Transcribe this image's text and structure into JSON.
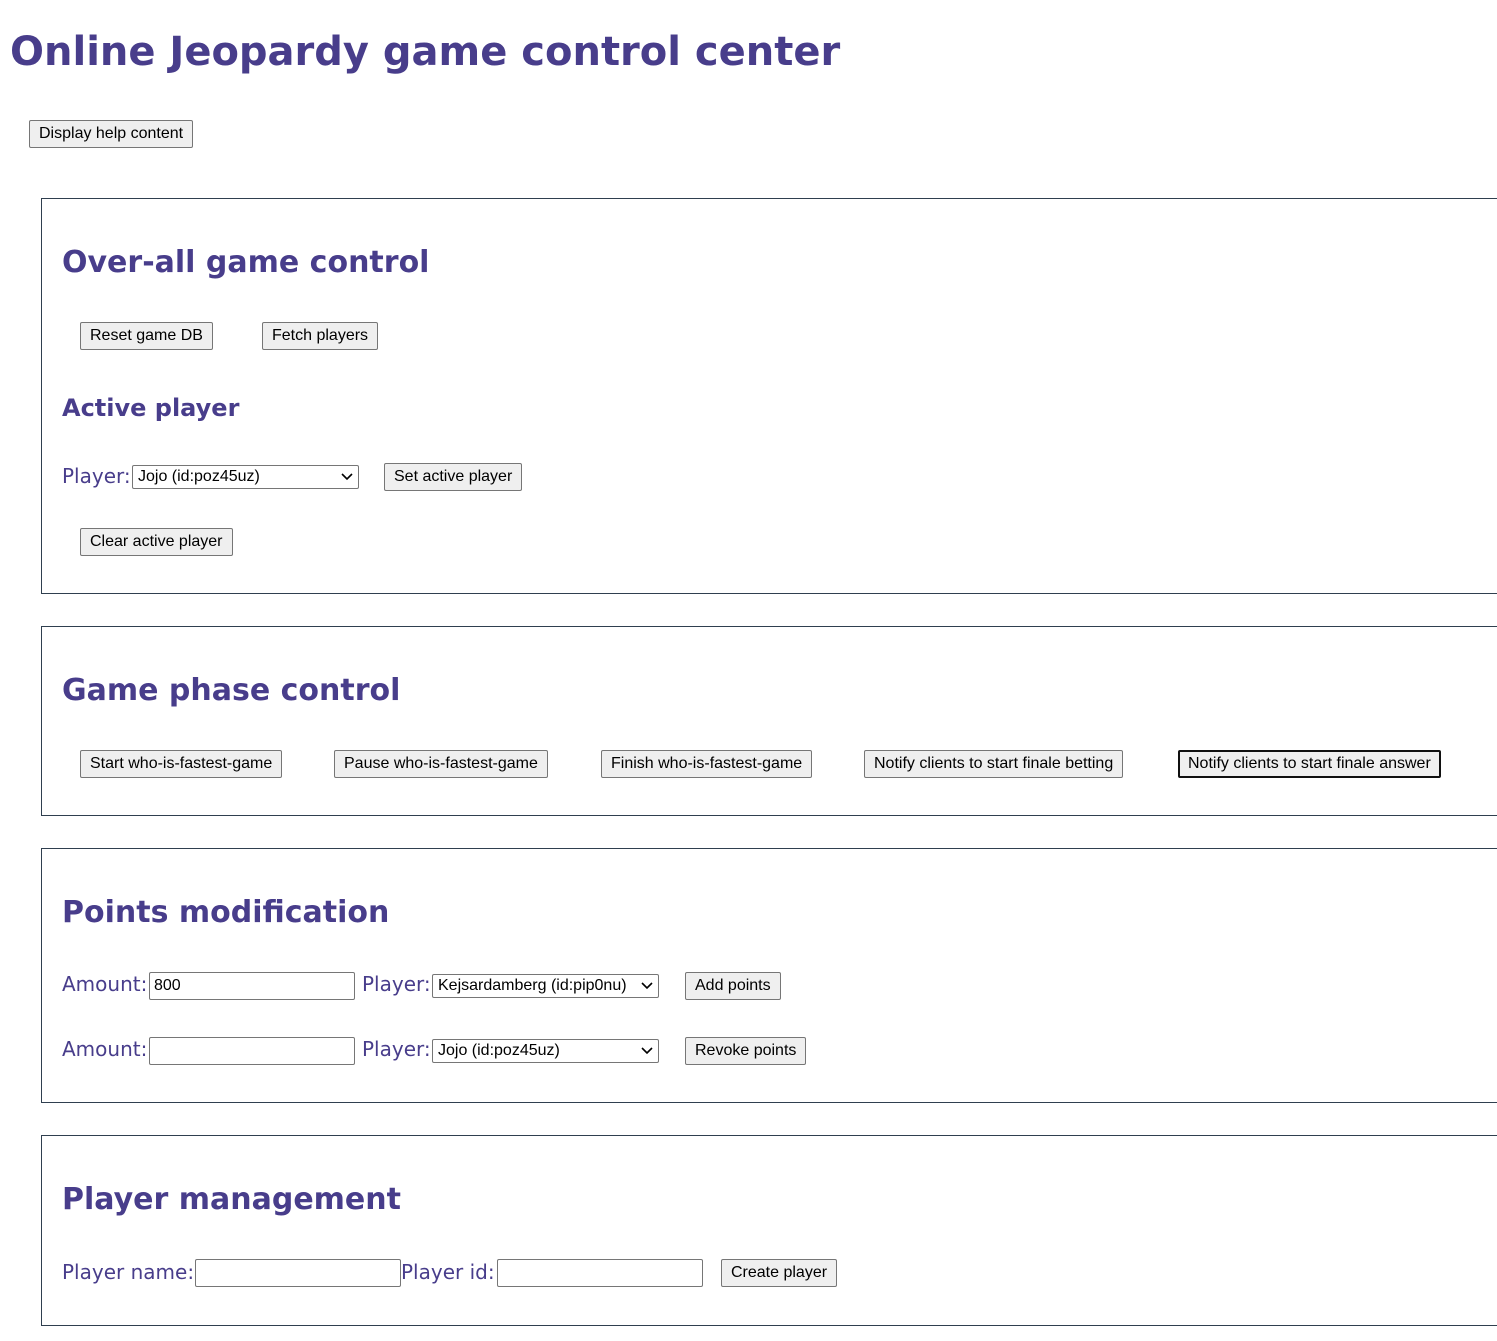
{
  "page": {
    "title": "Online Jeopardy game control center",
    "help_button": "Display help content"
  },
  "overall": {
    "title": "Over-all game control",
    "reset_button": "Reset game DB",
    "fetch_button": "Fetch players",
    "active_player_title": "Active player",
    "player_label": "Player:",
    "player_selected": "Jojo (id:poz45uz)",
    "set_active_button": "Set active player",
    "clear_active_button": "Clear active player"
  },
  "phase": {
    "title": "Game phase control",
    "buttons": [
      "Start who-is-fastest-game",
      "Pause who-is-fastest-game",
      "Finish who-is-fastest-game",
      "Notify clients to start finale betting",
      "Notify clients to start finale answer"
    ]
  },
  "points": {
    "title": "Points modification",
    "amount_label": "Amount:",
    "player_label": "Player:",
    "add": {
      "amount_value": "800",
      "player_selected": "Kejsardamberg (id:pip0nu)",
      "button": "Add points"
    },
    "revoke": {
      "amount_value": "",
      "player_selected": "Jojo (id:poz45uz)",
      "button": "Revoke points"
    }
  },
  "players": {
    "title": "Player management",
    "name_label": "Player name:",
    "name_value": "",
    "id_label": "Player id:",
    "id_value": "",
    "create_button": "Create player"
  }
}
